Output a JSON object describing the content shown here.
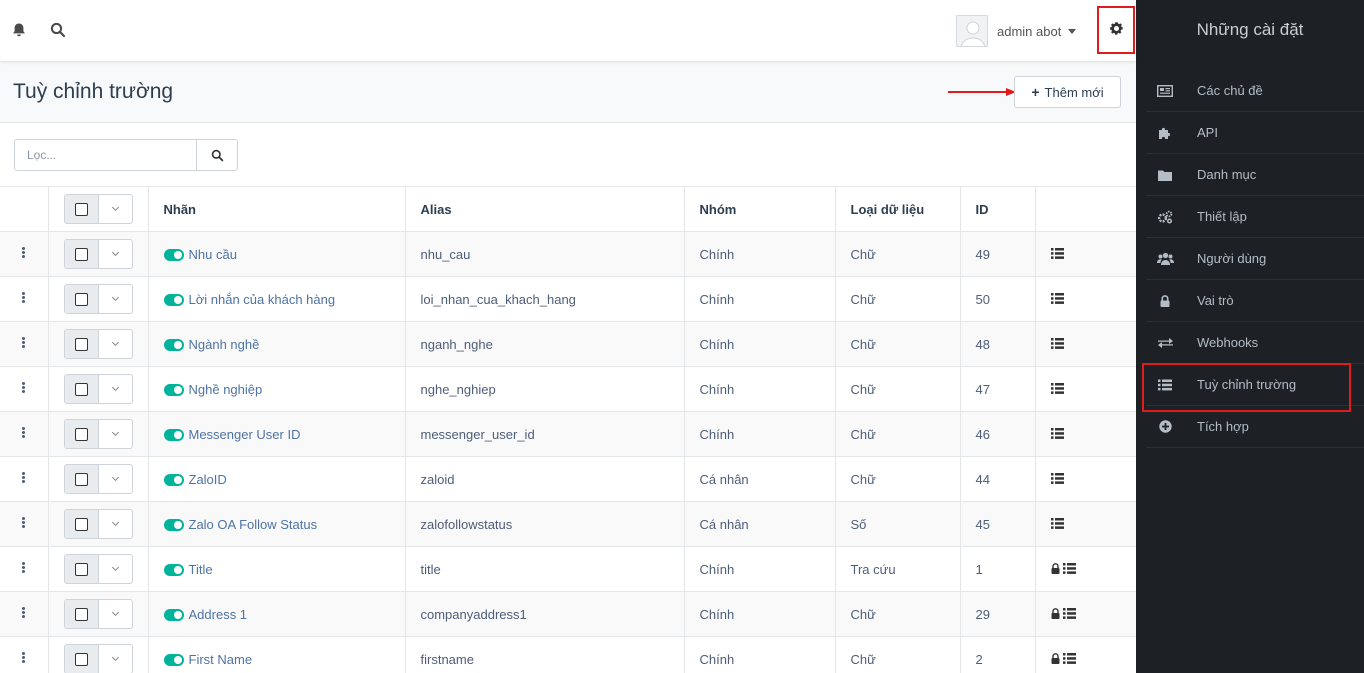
{
  "topbar": {
    "user_name": "admin abot",
    "icons": [
      "bell-icon",
      "search-icon",
      "gear-icon"
    ]
  },
  "page": {
    "title": "Tuỳ chỉnh trường",
    "add_button": "Thêm mới",
    "filter_placeholder": "Lọc..."
  },
  "table": {
    "headers": {
      "label": "Nhãn",
      "alias": "Alias",
      "group": "Nhóm",
      "type": "Loại dữ liệu",
      "id": "ID"
    },
    "rows": [
      {
        "label": "Nhu cầu",
        "alias": "nhu_cau",
        "group": "Chính",
        "type": "Chữ",
        "id": "49",
        "locked": false
      },
      {
        "label": "Lời nhắn của khách hàng",
        "alias": "loi_nhan_cua_khach_hang",
        "group": "Chính",
        "type": "Chữ",
        "id": "50",
        "locked": false
      },
      {
        "label": "Ngành nghề",
        "alias": "nganh_nghe",
        "group": "Chính",
        "type": "Chữ",
        "id": "48",
        "locked": false
      },
      {
        "label": "Nghề nghiệp",
        "alias": "nghe_nghiep",
        "group": "Chính",
        "type": "Chữ",
        "id": "47",
        "locked": false
      },
      {
        "label": "Messenger User ID",
        "alias": "messenger_user_id",
        "group": "Chính",
        "type": "Chữ",
        "id": "46",
        "locked": false
      },
      {
        "label": "ZaloID",
        "alias": "zaloid",
        "group": "Cá nhân",
        "type": "Chữ",
        "id": "44",
        "locked": false
      },
      {
        "label": "Zalo OA Follow Status",
        "alias": "zalofollowstatus",
        "group": "Cá nhân",
        "type": "Số",
        "id": "45",
        "locked": false
      },
      {
        "label": "Title",
        "alias": "title",
        "group": "Chính",
        "type": "Tra cứu",
        "id": "1",
        "locked": true
      },
      {
        "label": "Address 1",
        "alias": "companyaddress1",
        "group": "Chính",
        "type": "Chữ",
        "id": "29",
        "locked": true
      },
      {
        "label": "First Name",
        "alias": "firstname",
        "group": "Chính",
        "type": "Chữ",
        "id": "2",
        "locked": true
      }
    ]
  },
  "sidebar": {
    "title": "Những cài đặt",
    "items": [
      {
        "label": "Các chủ đề",
        "icon": "newspaper-icon"
      },
      {
        "label": "API",
        "icon": "puzzle-icon"
      },
      {
        "label": "Danh mục",
        "icon": "folder-icon"
      },
      {
        "label": "Thiết lập",
        "icon": "cogs-icon"
      },
      {
        "label": "Người dùng",
        "icon": "users-icon"
      },
      {
        "label": "Vai trò",
        "icon": "lock-icon"
      },
      {
        "label": "Webhooks",
        "icon": "exchange-icon"
      },
      {
        "label": "Tuỳ chỉnh trường",
        "icon": "list-icon"
      },
      {
        "label": "Tích hợp",
        "icon": "plus-circle-icon"
      }
    ]
  },
  "colors": {
    "accent_green": "#00b49c",
    "sidebar_bg": "#1d2125",
    "highlight_red": "#e01b1b",
    "link_blue": "#4e73a5"
  }
}
